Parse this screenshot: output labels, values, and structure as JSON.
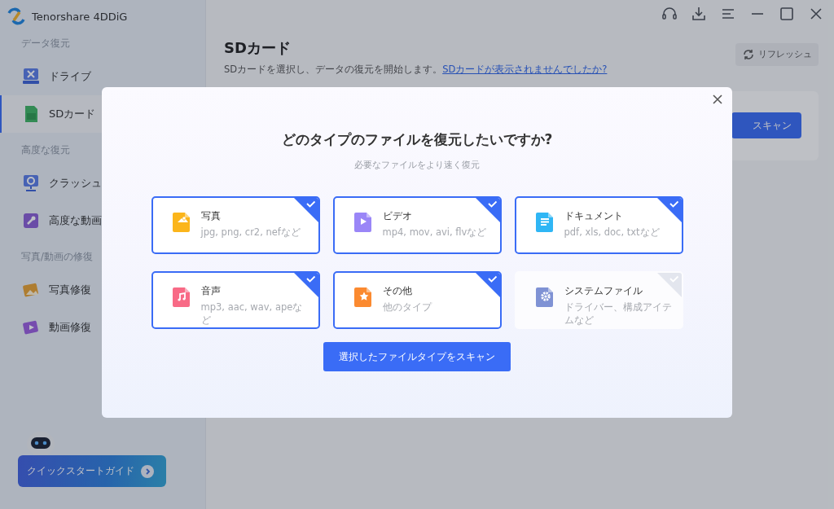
{
  "app": {
    "title": "Tenorshare 4DDiG"
  },
  "sidebar": {
    "sections": [
      {
        "heading": "データ復元",
        "items": [
          {
            "label": "ドライブ",
            "selected": false
          },
          {
            "label": "SDカード",
            "selected": true
          }
        ]
      },
      {
        "heading": "高度な復元",
        "items": [
          {
            "label": "クラッシュ",
            "selected": false
          },
          {
            "label": "高度な動画",
            "selected": false
          }
        ]
      },
      {
        "heading": "写真/動画の修復",
        "items": [
          {
            "label": "写真修復",
            "selected": false
          },
          {
            "label": "動画修復",
            "selected": false
          }
        ]
      }
    ],
    "guide_button": "クイックスタートガイド"
  },
  "main": {
    "title": "SDカード",
    "description": "SDカードを選択し、データの復元を開始します。",
    "help_link": "SDカードが表示されませんでしたか?",
    "refresh_button": "リフレッシュ",
    "scan_button": "スキャン"
  },
  "dialog": {
    "title": "どのタイプのファイルを復元したいですか?",
    "subtitle": "必要なファイルをより速く復元",
    "file_types": [
      {
        "name": "写真",
        "formats": "jpg, png, cr2, nefなど",
        "color": "#fbb51b",
        "selected": true
      },
      {
        "name": "ビデオ",
        "formats": "mp4, mov, avi, flvなど",
        "color": "#9a86f7",
        "selected": true
      },
      {
        "name": "ドキュメント",
        "formats": "pdf, xls, doc, txtなど",
        "color": "#2fb6f5",
        "selected": true
      },
      {
        "name": "音声",
        "formats": "mp3, aac, wav, apeなど",
        "color": "#f86a86",
        "selected": true
      },
      {
        "name": "その他",
        "formats": "他のタイプ",
        "color": "#fb8a30",
        "selected": true
      },
      {
        "name": "システムファイル",
        "formats": "ドライバー、構成アイテムなど",
        "color": "#7f92d4",
        "selected": false
      }
    ],
    "scan_button": "選択したファイルタイプをスキャン"
  }
}
